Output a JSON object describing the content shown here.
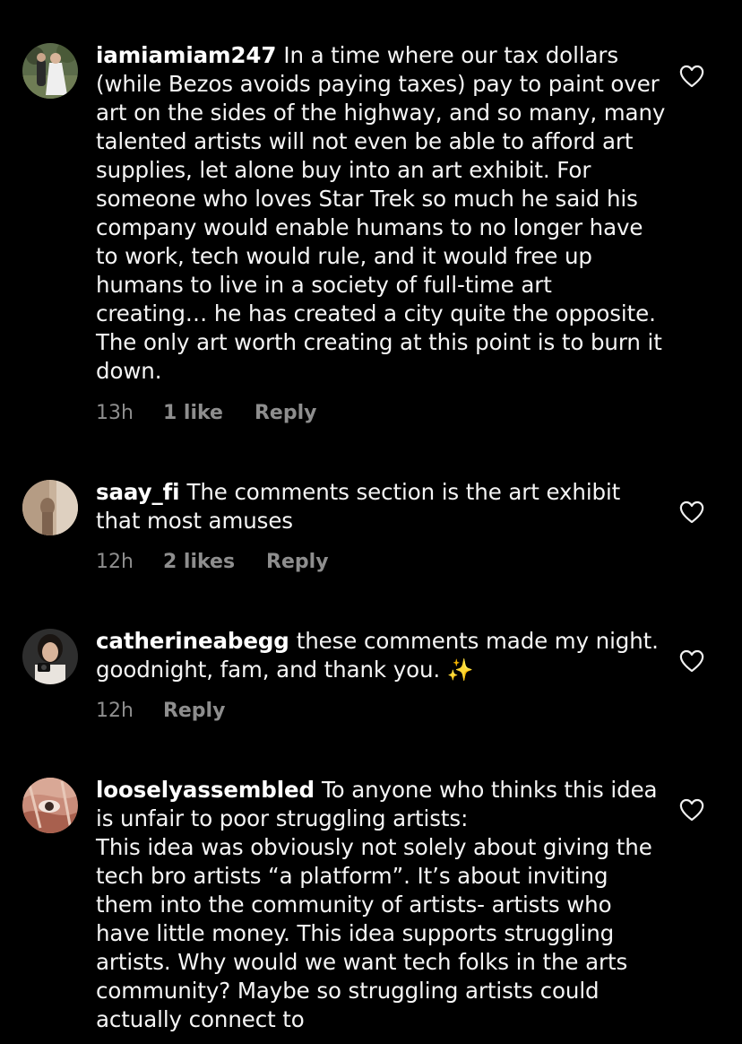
{
  "comments": [
    {
      "username": "iamiamiam247",
      "text": "In a time where our tax dollars (while Bezos avoids paying taxes) pay to paint over art on the sides of the highway, and so many, many talented artists will not even be able to afford art supplies, let alone buy into an art exhibit. For someone who loves Star Trek so much he said his company would enable humans to no longer have to work, tech would rule, and it would free up humans to live in a society of full-time art creating… he has created a city quite the opposite. The only art worth creating at this point is to burn it down.",
      "time": "13h",
      "likes": "1 like",
      "reply": "Reply"
    },
    {
      "username": "saay_fi",
      "text": "The comments section is the art exhibit that most amuses",
      "time": "12h",
      "likes": "2 likes",
      "reply": "Reply"
    },
    {
      "username": "catherineabegg",
      "text": "these comments made my night. goodnight, fam, and thank you.",
      "emoji": "✨",
      "time": "12h",
      "reply": "Reply"
    },
    {
      "username": "looselyassembled",
      "text": "To anyone who thinks this idea is unfair to poor struggling artists:",
      "text2": "This idea was obviously not solely about giving the tech bro artists “a platform”. It’s about inviting them into the community of artists- artists who have little money.  This idea supports struggling artists. Why would we want tech folks in the arts community? Maybe so struggling artists could actually connect to"
    }
  ],
  "icons": {
    "like": "heart-outline-icon"
  },
  "colors": {
    "background": "#000000",
    "text": "#f5f5f5",
    "meta": "#8e8e8e"
  }
}
